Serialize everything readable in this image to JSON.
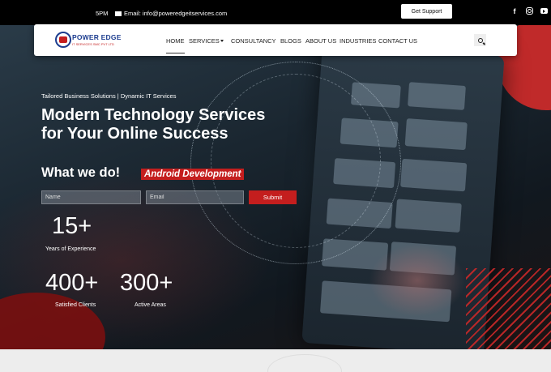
{
  "topbar": {
    "hours": "5PM",
    "email": "Email: info@poweredgeitservices.com",
    "support_button": "Get Support",
    "social": [
      "facebook-icon",
      "instagram-icon",
      "youtube-icon"
    ]
  },
  "brand": {
    "name": "POWER EDGE",
    "subtitle": "IT SERVICES SMC PVT LTD",
    "primary_color": "#1d3d8f",
    "accent_color": "#c41e1e"
  },
  "nav": {
    "items": [
      {
        "label": "HOME",
        "active": true
      },
      {
        "label": "SERVICES"
      },
      {
        "label": "CONSULTANCY"
      },
      {
        "label": "BLOGS"
      },
      {
        "label": "ABOUT US"
      },
      {
        "label": "INDUSTRIES"
      },
      {
        "label": "CONTACT US"
      }
    ]
  },
  "hero": {
    "tagline": "Tailored Business Solutions | Dynamic IT Services",
    "headline": "Modern Technology Services for Your Online Success",
    "what_we_do": "What we do!",
    "what_we_do_tag": "Android Development",
    "form": {
      "name_placeholder": "Name",
      "email_placeholder": "Email",
      "submit_label": "Submit"
    },
    "stats": [
      {
        "value": "15+",
        "label": "Years of Experience"
      },
      {
        "value": "400+",
        "label": "Satisfied Clients"
      },
      {
        "value": "300+",
        "label": "Active Areas"
      }
    ]
  }
}
